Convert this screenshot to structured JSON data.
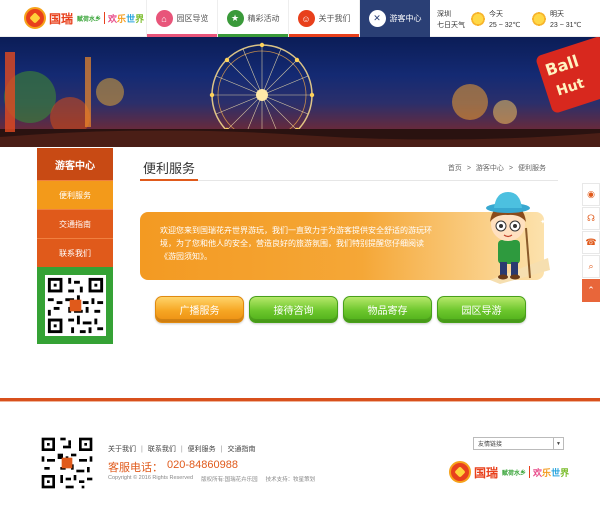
{
  "header": {
    "logo": {
      "brand": "国瑞",
      "slogan": "赋荷水乡",
      "world": [
        "欢",
        "乐",
        "世",
        "界"
      ]
    },
    "nav": [
      {
        "label": "园区导览",
        "icon": "house-icon",
        "color": "#e8557a",
        "active": false
      },
      {
        "label": "精彩活动",
        "icon": "star-icon",
        "color": "#3a9a3a",
        "active": false
      },
      {
        "label": "关于我们",
        "icon": "person-icon",
        "color": "#e8401c",
        "active": false
      },
      {
        "label": "游客中心",
        "icon": "wrench-icon",
        "color": "#2a3f75",
        "active": true
      }
    ],
    "weather": {
      "city": "深圳",
      "source": "七日天气",
      "today": {
        "label": "今天",
        "temp": "25 ~ 32℃",
        "icon": "sun-icon"
      },
      "tomorrow": {
        "label": "明天",
        "temp": "23 ~ 31℃",
        "icon": "sun-icon"
      }
    }
  },
  "sidebar": {
    "title": "游客中心",
    "items": [
      {
        "label": "便利服务",
        "active": true
      },
      {
        "label": "交通指南",
        "active": false
      },
      {
        "label": "联系我们",
        "active": false
      }
    ]
  },
  "main": {
    "title": "便利服务",
    "breadcrumb": [
      "首页",
      "游客中心",
      "便利服务"
    ],
    "notice": "欢迎您来到国瑞花卉世界游玩，我们一直致力于为游客提供安全舒适的游玩环境，为了您和他人的安全，营造良好的旅游氛围，我们特别提醒您仔细阅读《游园须知》。",
    "services": [
      {
        "label": "广播服务",
        "style": "orange"
      },
      {
        "label": "接待咨询",
        "style": "green"
      },
      {
        "label": "物品寄存",
        "style": "green"
      },
      {
        "label": "园区导游",
        "style": "green"
      }
    ]
  },
  "floatbar": [
    "weibo-icon",
    "wechat-icon",
    "phone-icon",
    "search-icon",
    "back-to-top-icon"
  ],
  "footer": {
    "links": [
      "关于我们",
      "联系我们",
      "便利服务",
      "交通指南"
    ],
    "hotline_label": "客服电话：",
    "hotline_number": "020-84860988",
    "copyright": "Copyright © 2016 Rights Reserved",
    "owner": "版权所有:国瑞花卉乐园",
    "support": "技术支持：牧星策划",
    "friend_links": "友情链接"
  },
  "colors": {
    "accent": "#e05a1b",
    "navy": "#2a3f75",
    "green": "#35a235",
    "orange": "#f39a1a"
  }
}
